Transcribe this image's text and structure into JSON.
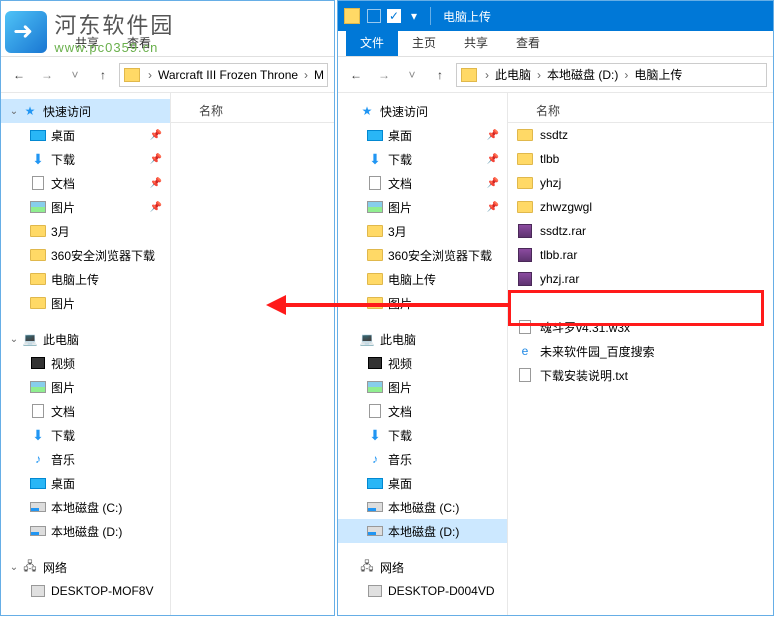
{
  "watermark": {
    "title": "河东软件园",
    "url": "www.pc0359.cn"
  },
  "ribbon": {
    "file": "文件",
    "home": "主页",
    "share": "共享",
    "view": "查看"
  },
  "columnHeader": "名称",
  "leftWindow": {
    "breadcrumb": [
      "Warcraft III Frozen Throne",
      "M"
    ]
  },
  "rightWindow": {
    "title": "电脑上传",
    "breadcrumb": [
      "此电脑",
      "本地磁盘 (D:)",
      "电脑上传"
    ]
  },
  "tree": {
    "quickAccess": "快速访问",
    "desktop": "桌面",
    "downloads": "下载",
    "documents": "文档",
    "pictures": "图片",
    "month3": "3月",
    "browser360": "360安全浏览器下载",
    "upload": "电脑上传",
    "pictures2": "图片",
    "thisPC": "此电脑",
    "video": "视频",
    "music": "音乐",
    "diskC": "本地磁盘 (C:)",
    "diskD": "本地磁盘 (D:)",
    "network": "网络",
    "compLeft": "DESKTOP-MOF8V",
    "compRight": "DESKTOP-D004VD"
  },
  "files": {
    "ssdtz": "ssdtz",
    "tlbb": "tlbb",
    "yhzj": "yhzj",
    "zhwzgwgl": "zhwzgwgl",
    "ssdtzRar": "ssdtz.rar",
    "tlbbRar": "tlbb.rar",
    "yhzjRar": "yhzj.rar",
    "hundouluo": "魂斗罗v4.31.w3x",
    "weilai": "未来软件园_百度搜索",
    "instructions": "下载安装说明.txt"
  }
}
